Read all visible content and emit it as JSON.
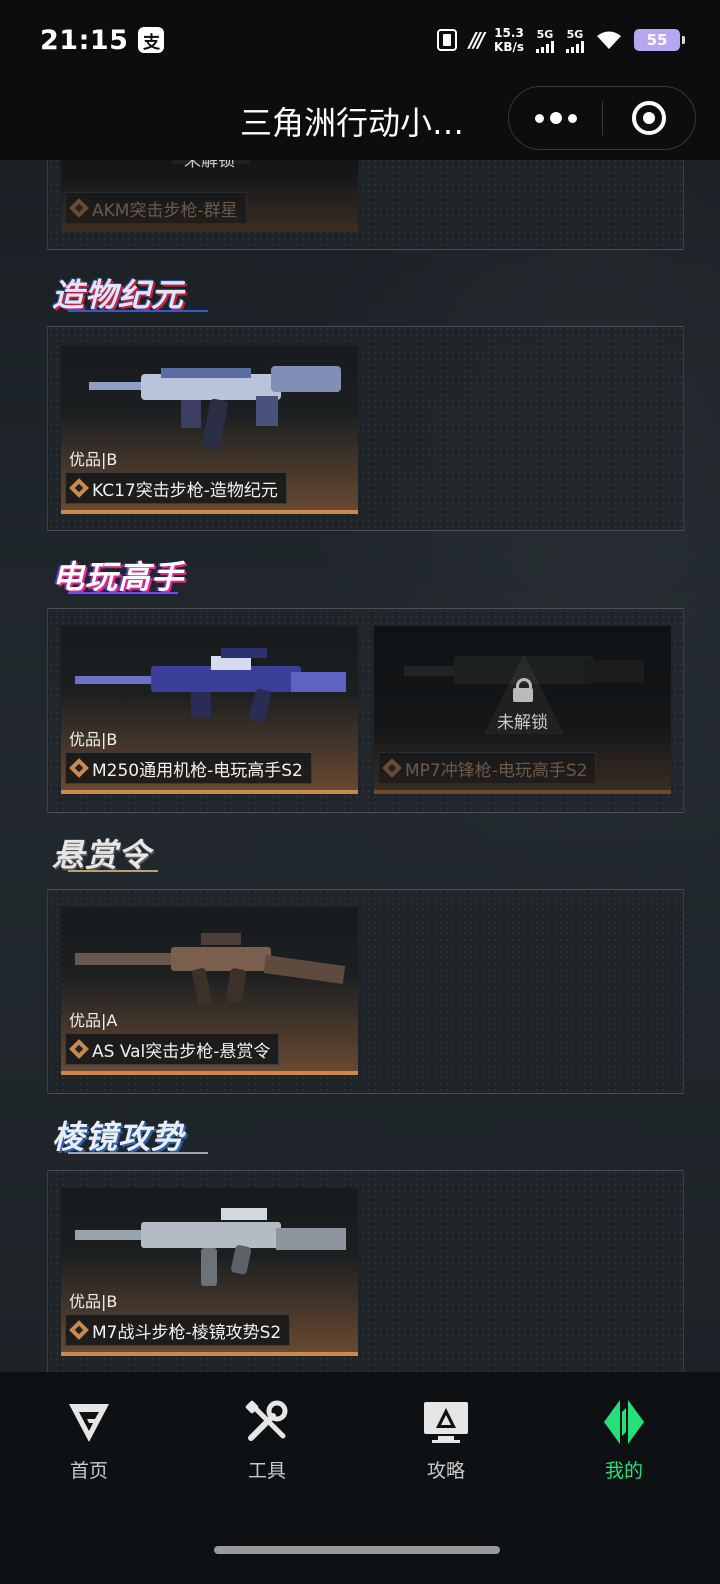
{
  "status_bar": {
    "time": "21:15",
    "tag": "支",
    "net_speed_value": "15.3",
    "net_speed_unit": "KB/s",
    "signal_1": "5G",
    "signal_2": "5G",
    "battery": "55"
  },
  "header": {
    "title": "三角洲行动小…"
  },
  "sections": [
    {
      "logo": "",
      "cards": [
        {
          "quality": "",
          "name": "AKM突击步枪-群星",
          "locked": true,
          "lock_text": "未解锁"
        }
      ]
    },
    {
      "logo": "造物纪元",
      "cards": [
        {
          "quality": "优品|B",
          "name": "KC17突击步枪-造物纪元",
          "locked": false
        }
      ]
    },
    {
      "logo": "电玩高手",
      "cards": [
        {
          "quality": "优品|B",
          "name": "M250通用机枪-电玩高手S2",
          "locked": false
        },
        {
          "quality": "",
          "name": "MP7冲锋枪-电玩高手S2",
          "locked": true,
          "lock_text": "未解锁"
        }
      ]
    },
    {
      "logo": "悬赏令",
      "cards": [
        {
          "quality": "优品|A",
          "name": "AS Val突击步枪-悬赏令",
          "locked": false
        }
      ]
    },
    {
      "logo": "棱镜攻势",
      "cards": [
        {
          "quality": "优品|B",
          "name": "M7战斗步枪-棱镜攻势S2",
          "locked": false
        }
      ]
    }
  ],
  "tabbar": {
    "items": [
      {
        "label": "首页",
        "icon": "home-logo-icon",
        "active": false
      },
      {
        "label": "工具",
        "icon": "tools-icon",
        "active": false
      },
      {
        "label": "攻略",
        "icon": "guide-monitor-icon",
        "active": false
      },
      {
        "label": "我的",
        "icon": "profile-logo-icon",
        "active": true
      }
    ],
    "active_color": "#24e07a"
  },
  "colors": {
    "accent_orange": "#c98a4e",
    "background": "#1c2226"
  }
}
